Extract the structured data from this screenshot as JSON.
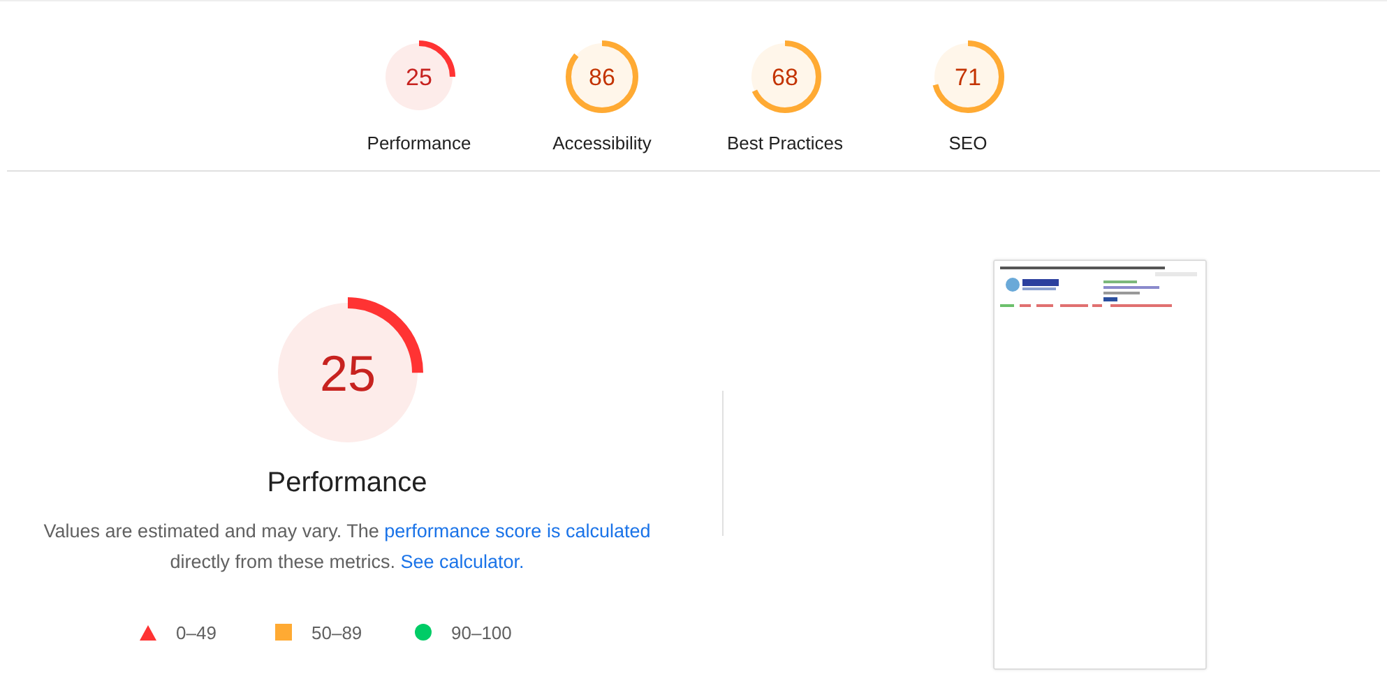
{
  "categories": [
    {
      "score": "25",
      "label": "Performance",
      "level": 0.25,
      "kind": "fail"
    },
    {
      "score": "86",
      "label": "Accessibility",
      "level": 0.86,
      "kind": "average"
    },
    {
      "score": "68",
      "label": "Best Practices",
      "level": 0.68,
      "kind": "average"
    },
    {
      "score": "71",
      "label": "SEO",
      "level": 0.71,
      "kind": "average"
    }
  ],
  "main": {
    "score": "25",
    "level": 0.25,
    "kind": "fail",
    "title": "Performance",
    "description": [
      {
        "kind": "text",
        "text": "Values are estimated and may vary. The "
      },
      {
        "kind": "link",
        "text": "performance score is calculated"
      },
      {
        "kind": "text",
        "text": " directly from these metrics. "
      },
      {
        "kind": "link",
        "text": "See calculator."
      }
    ],
    "legend": [
      {
        "kind": "fail",
        "text": "0–49"
      },
      {
        "kind": "average",
        "text": "50–89"
      },
      {
        "kind": "pass",
        "text": "90–100"
      }
    ]
  }
}
